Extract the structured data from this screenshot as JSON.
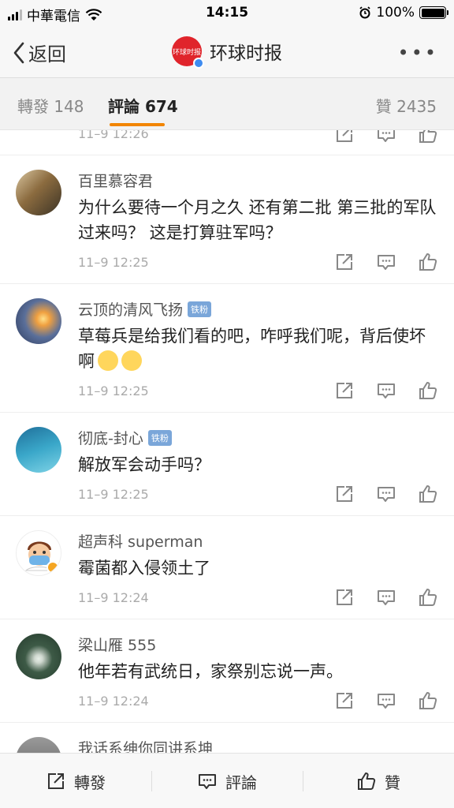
{
  "status_bar": {
    "carrier": "中華電信",
    "time": "14:15",
    "battery": "100%",
    "battery_level": 1.0
  },
  "nav": {
    "back_label": "返回",
    "logo_text": "环球时报",
    "title": "环球时报",
    "more": "•••"
  },
  "tabs": {
    "repost": "轉發 148",
    "comments": "評論 674",
    "likes": "贊 2435"
  },
  "partial_row": {
    "time": "11–9 12:26"
  },
  "comments": [
    {
      "user": "百里慕容君",
      "badge": "",
      "text": "为什么要待一个月之久 还有第二批 第三批的军队过来吗？ 这是打算驻军吗？",
      "time": "11–9 12:25"
    },
    {
      "user": "云顶的清风飞扬",
      "badge": "铁粉",
      "text": "草莓兵是给我们看的吧，咋呼我们呢，背后使坏啊",
      "time": "11–9 12:25"
    },
    {
      "user": "彻底-封心",
      "badge": "铁粉",
      "text": "解放军会动手吗？",
      "time": "11–9 12:25"
    },
    {
      "user": "超声科 superman",
      "badge": "",
      "text": "霉菌都入侵领土了",
      "time": "11–9 12:24"
    },
    {
      "user": "梁山雁 555",
      "badge": "",
      "text": "他年若有武统日，家祭别忘说一声。",
      "time": "11–9 12:24"
    },
    {
      "user": "我话系绅你同讲系坤",
      "badge": "",
      "text": "",
      "time": ""
    }
  ],
  "bottom_bar": {
    "repost": "轉發",
    "comment": "評論",
    "like": "贊"
  },
  "colors": {
    "accent": "#f28500",
    "brand_red": "#e0242b",
    "fan_badge": "#7aa6d9",
    "verified_blue": "#3f8cf0"
  }
}
